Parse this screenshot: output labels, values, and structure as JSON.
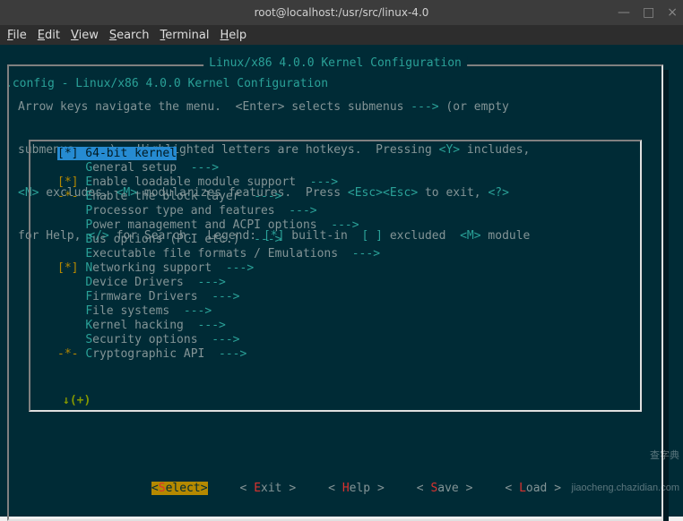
{
  "window": {
    "title": "root@localhost:/usr/src/linux-4.0"
  },
  "menubar": {
    "items": [
      {
        "mn": "F",
        "rest": "ile"
      },
      {
        "mn": "E",
        "rest": "dit"
      },
      {
        "mn": "V",
        "rest": "iew"
      },
      {
        "mn": "S",
        "rest": "earch"
      },
      {
        "mn": "T",
        "rest": "erminal"
      },
      {
        "mn": "H",
        "rest": "elp"
      }
    ]
  },
  "header": {
    "text": ".config - Linux/x86 4.0.0 Kernel Configuration"
  },
  "frame": {
    "title": "Linux/x86 4.0.0 Kernel Configuration"
  },
  "help": {
    "l1a": "Arrow keys navigate the menu.  <Enter> selects submenus ",
    "l1b": " (or empty",
    "l2a": "submenus ",
    "l2b": ").  Highlighted letters are hotkeys.  Pressing ",
    "l2c": " includes,",
    "l3a": " excludes, ",
    "l3b": " modularizes features.  Press ",
    "l3c": " to exit, ",
    "l4a": "for Help, ",
    "l4b": " for Search.  Legend: ",
    "l4c": " built-in  ",
    "l4d": " excluded  ",
    "l4e": " module",
    "arrow3": "--->",
    "dash4": "----",
    "Y": "<Y>",
    "N": "<N>",
    "M": "<M>",
    "Esc": "<Esc><Esc>",
    "Q": "<?>",
    "Slash": "</>",
    "bi": "[*]",
    "ex": "[ ]",
    "mm": "<M>"
  },
  "items": [
    {
      "pre": "[*] ",
      "hk": "6",
      "rest": "4-bit kernel",
      "arrow": "",
      "sel": true
    },
    {
      "pre": "    ",
      "hk": "G",
      "rest": "eneral setup  ",
      "arrow": "--->"
    },
    {
      "pre": "[*] ",
      "hk": "E",
      "rest": "nable loadable module support  ",
      "arrow": "--->"
    },
    {
      "pre": "-*- ",
      "hk": "E",
      "rest": "nable the block layer  ",
      "arrow": "--->"
    },
    {
      "pre": "    ",
      "hk": "P",
      "rest": "rocessor type and features  ",
      "arrow": "--->"
    },
    {
      "pre": "    ",
      "hk": "P",
      "rest": "ower management and ACPI options  ",
      "arrow": "--->"
    },
    {
      "pre": "    ",
      "hk": "B",
      "rest": "us options (PCI etc.)  ",
      "arrow": "--->"
    },
    {
      "pre": "    ",
      "hk": "E",
      "rest": "xecutable file formats / Emulations  ",
      "arrow": "--->"
    },
    {
      "pre": "[*] ",
      "hk": "N",
      "rest": "etworking support  ",
      "arrow": "--->"
    },
    {
      "pre": "    ",
      "hk": "D",
      "rest": "evice Drivers  ",
      "arrow": "--->"
    },
    {
      "pre": "    ",
      "hk": "F",
      "rest": "irmware Drivers  ",
      "arrow": "--->"
    },
    {
      "pre": "    ",
      "hk": "F",
      "rest": "ile systems  ",
      "arrow": "--->"
    },
    {
      "pre": "    ",
      "hk": "K",
      "rest": "ernel hacking  ",
      "arrow": "--->"
    },
    {
      "pre": "    ",
      "hk": "S",
      "rest": "ecurity options  ",
      "arrow": "--->"
    },
    {
      "pre": "-*- ",
      "hk": "C",
      "rest": "ryptographic API  ",
      "arrow": "--->"
    }
  ],
  "scroll": {
    "text": "↓(+)"
  },
  "buttons": {
    "select": {
      "open": "<",
      "hk": "S",
      "mid": "elect",
      "close": ">"
    },
    "exit": {
      "open": "< ",
      "hk": "E",
      "mid": "xit ",
      "close": ">"
    },
    "help": {
      "open": "< ",
      "hk": "H",
      "mid": "elp ",
      "close": ">"
    },
    "save": {
      "open": "< ",
      "hk": "S",
      "mid": "ave ",
      "close": ">"
    },
    "load": {
      "open": "< ",
      "hk": "L",
      "mid": "oad ",
      "close": ">"
    }
  },
  "watermark": {
    "l1": "查字典",
    "l2": "jiaocheng.chazidian.com"
  }
}
